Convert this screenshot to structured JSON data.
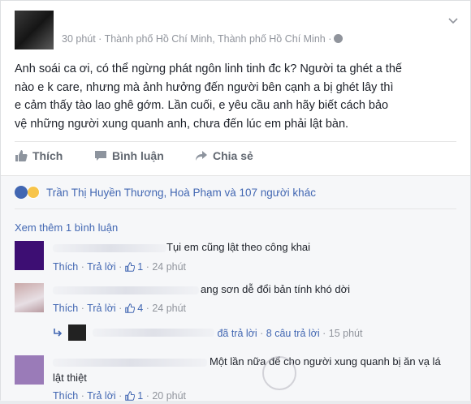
{
  "post": {
    "meta_text": "30 phút · Thành phố Hồ Chí Minh, Thành phố Hồ Chí Minh ·",
    "body_lines": [
      "Anh soái ca ơi, có thể ngừng phát ngôn linh tinh đc k? Người ta ghét a thế",
      "nào e k care, nhưng mà ảnh hưởng đến người bên cạnh a bị ghét lây thì",
      "e cảm thấy tào lao ghê gớm. Lần cuối, e yêu cầu anh hãy biết cách bảo",
      "vệ những người xung quanh anh, chưa đến lúc em phải lật bàn."
    ]
  },
  "actions": {
    "like": "Thích",
    "comment": "Bình luận",
    "share": "Chia sẻ"
  },
  "reactions": {
    "text": "Trần Thị Huyền Thương, Hoà Phạm và 107 người khác"
  },
  "view_more": "Xem thêm 1 bình luận",
  "comments": [
    {
      "text": "Tụi em cũng lật theo công khai",
      "like": "Thích",
      "reply": "Trả lời",
      "likes": "1",
      "time": "24 phút"
    },
    {
      "text": "ang sơn dễ đổi bản tính khó dời",
      "like": "Thích",
      "reply": "Trả lời",
      "likes": "4",
      "time": "24 phút"
    },
    {
      "text": "Một lần nữa để cho người xung quanh bị ăn vạ lá",
      "text2": "lật thiệt",
      "like": "Thích",
      "reply": "Trả lời",
      "likes": "1",
      "time": "20 phút"
    }
  ],
  "reply_summary": {
    "replied": "đã trả lời",
    "count": "8 câu trả lời",
    "time": "15 phút"
  },
  "colors": {
    "link": "#4267b2",
    "muted": "#90949c",
    "avatar1": "#3d0e73",
    "avatar3": "#9a7bb8"
  },
  "icons": [
    "chevron-down-icon",
    "globe-icon",
    "thumbs-up-icon",
    "comment-icon",
    "share-icon",
    "like-reaction-icon",
    "haha-reaction-icon",
    "reply-arrow-icon"
  ]
}
